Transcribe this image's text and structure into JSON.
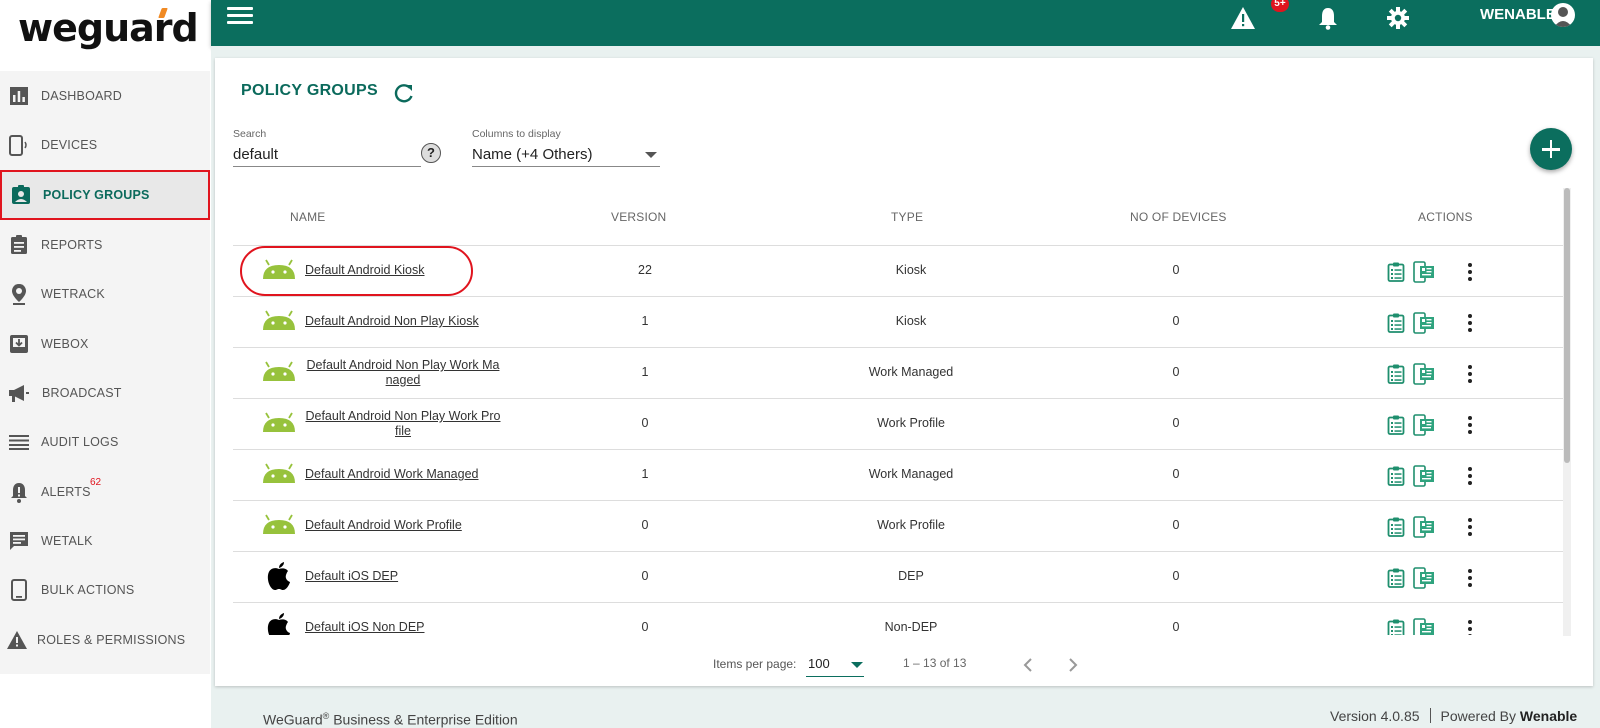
{
  "app": {
    "logo_text": "weguard"
  },
  "sidebar": {
    "items": [
      {
        "label": "DASHBOARD",
        "icon": "bar-chart-icon"
      },
      {
        "label": "DEVICES",
        "icon": "device-icon"
      },
      {
        "label": "POLICY GROUPS",
        "icon": "policy-badge-icon",
        "active": true
      },
      {
        "label": "REPORTS",
        "icon": "clipboard-icon"
      },
      {
        "label": "WETRACK",
        "icon": "location-pin-icon"
      },
      {
        "label": "WEBOX",
        "icon": "download-box-icon"
      },
      {
        "label": "BROADCAST",
        "icon": "megaphone-icon"
      },
      {
        "label": "AUDIT LOGS",
        "icon": "list-icon"
      },
      {
        "label": "ALERTS",
        "icon": "bell-alert-icon",
        "badge": "62"
      },
      {
        "label": "WETALK",
        "icon": "chat-icon"
      },
      {
        "label": "BULK ACTIONS",
        "icon": "phone-icon"
      },
      {
        "label": "ROLES & PERMISSIONS",
        "icon": "warning-icon"
      }
    ]
  },
  "header": {
    "alert_badge": "5+",
    "user_name": "WENABLE"
  },
  "page": {
    "title": "POLICY GROUPS",
    "search_label": "Search",
    "search_value": "default",
    "help_label": "?",
    "columns_label": "Columns to display",
    "columns_value": "Name (+4 Others)"
  },
  "table": {
    "headers": {
      "name": "NAME",
      "version": "VERSION",
      "type": "TYPE",
      "devices": "NO OF DEVICES",
      "actions": "ACTIONS"
    },
    "rows": [
      {
        "os": "android",
        "name": "Default Android Kiosk",
        "version": "22",
        "type": "Kiosk",
        "devices": "0"
      },
      {
        "os": "android",
        "name": "Default Android Non Play Kiosk",
        "version": "1",
        "type": "Kiosk",
        "devices": "0"
      },
      {
        "os": "android",
        "name_line1": "Default Android Non Play Work Ma",
        "name_line2": "naged",
        "version": "1",
        "type": "Work Managed",
        "devices": "0"
      },
      {
        "os": "android",
        "name_line1": "Default Android Non Play Work Pro",
        "name_line2": "file",
        "version": "0",
        "type": "Work Profile",
        "devices": "0"
      },
      {
        "os": "android",
        "name": "Default Android Work Managed",
        "version": "1",
        "type": "Work Managed",
        "devices": "0"
      },
      {
        "os": "android",
        "name": "Default Android Work Profile",
        "version": "0",
        "type": "Work Profile",
        "devices": "0"
      },
      {
        "os": "ios",
        "name": "Default iOS DEP",
        "version": "0",
        "type": "DEP",
        "devices": "0"
      },
      {
        "os": "ios",
        "name": "Default iOS Non DEP",
        "version": "0",
        "type": "Non-DEP",
        "devices": "0"
      }
    ]
  },
  "paginator": {
    "items_label": "Items per page:",
    "page_size": "100",
    "range": "1 – 13 of 13"
  },
  "footer": {
    "edition_brand": "WeGuard",
    "edition_reg": "®",
    "edition_text": " Business & Enterprise Edition",
    "version": "Version 4.0.85",
    "powered_label": "Powered By ",
    "powered_brand": "Wenable"
  },
  "colors": {
    "primary": "#0b6e5e",
    "highlight": "#e0141e",
    "android": "#97c23c"
  }
}
